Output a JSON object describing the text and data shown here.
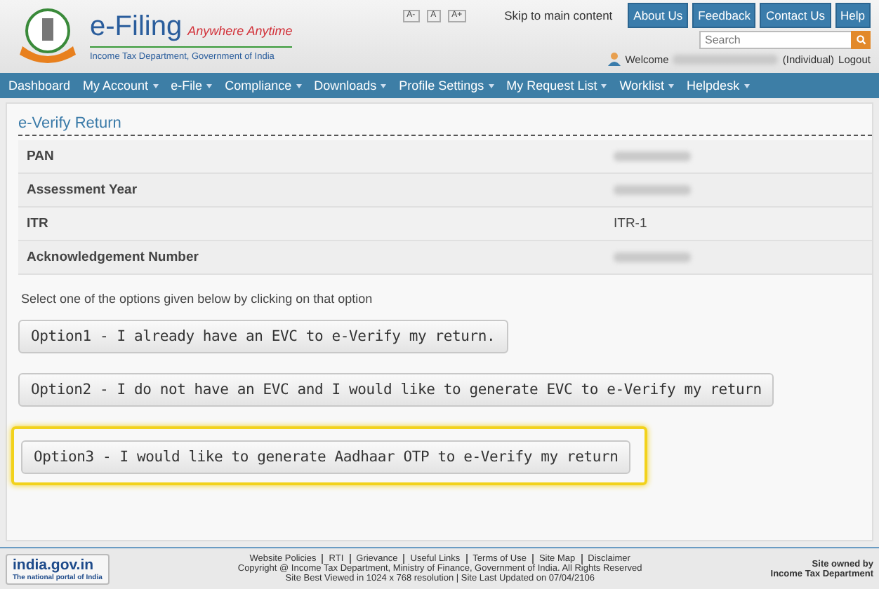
{
  "header": {
    "brand": "e-Filing",
    "tagline": "Anywhere Anytime",
    "subtitle": "Income Tax Department, Government of India",
    "font_sizes": [
      "A-",
      "A",
      "A+"
    ],
    "skip_link": "Skip to main content",
    "top_buttons": [
      "About Us",
      "Feedback",
      "Contact Us",
      "Help"
    ],
    "search": {
      "placeholder": "Search"
    },
    "welcome": "Welcome",
    "user_type": "(Individual)",
    "logout": "Logout"
  },
  "nav": [
    {
      "label": "Dashboard",
      "dropdown": false
    },
    {
      "label": "My Account",
      "dropdown": true
    },
    {
      "label": "e-File",
      "dropdown": true
    },
    {
      "label": "Compliance",
      "dropdown": true
    },
    {
      "label": "Downloads",
      "dropdown": true
    },
    {
      "label": "Profile Settings",
      "dropdown": true
    },
    {
      "label": "My Request List",
      "dropdown": true
    },
    {
      "label": "Worklist",
      "dropdown": true
    },
    {
      "label": "Helpdesk",
      "dropdown": true
    }
  ],
  "page_title": "e-Verify Return",
  "details": [
    {
      "label": "PAN"
    },
    {
      "label": "Assessment Year"
    },
    {
      "label": "ITR",
      "value": "ITR-1"
    },
    {
      "label": "Acknowledgement Number"
    }
  ],
  "instruction": "Select one of the options given below by clicking on that option",
  "options": [
    {
      "label": "Option1 - I already have an EVC to e-Verify my return.",
      "highlighted": false
    },
    {
      "label": "Option2 - I do not have an EVC and I would like to generate EVC to e-Verify my return",
      "highlighted": false
    },
    {
      "label": "Option3 - I would like to generate Aadhaar OTP to e-Verify my return",
      "highlighted": true
    }
  ],
  "footer": {
    "portal": "india.gov.in",
    "portal_tagline": "The national portal of India",
    "links": [
      "Website Policies",
      "RTI",
      "Grievance",
      "Useful Links",
      "Terms of Use",
      "Site Map",
      "Disclaimer"
    ],
    "copyright": "Copyright @ Income Tax Department, Ministry of Finance, Government of India. All Rights Reserved",
    "best_viewed": "Site Best Viewed in 1024 x 768 resolution | Site Last Updated on 07/04/2106",
    "owner_line_1": "Site owned by",
    "owner_line_2": "Income Tax Department"
  }
}
